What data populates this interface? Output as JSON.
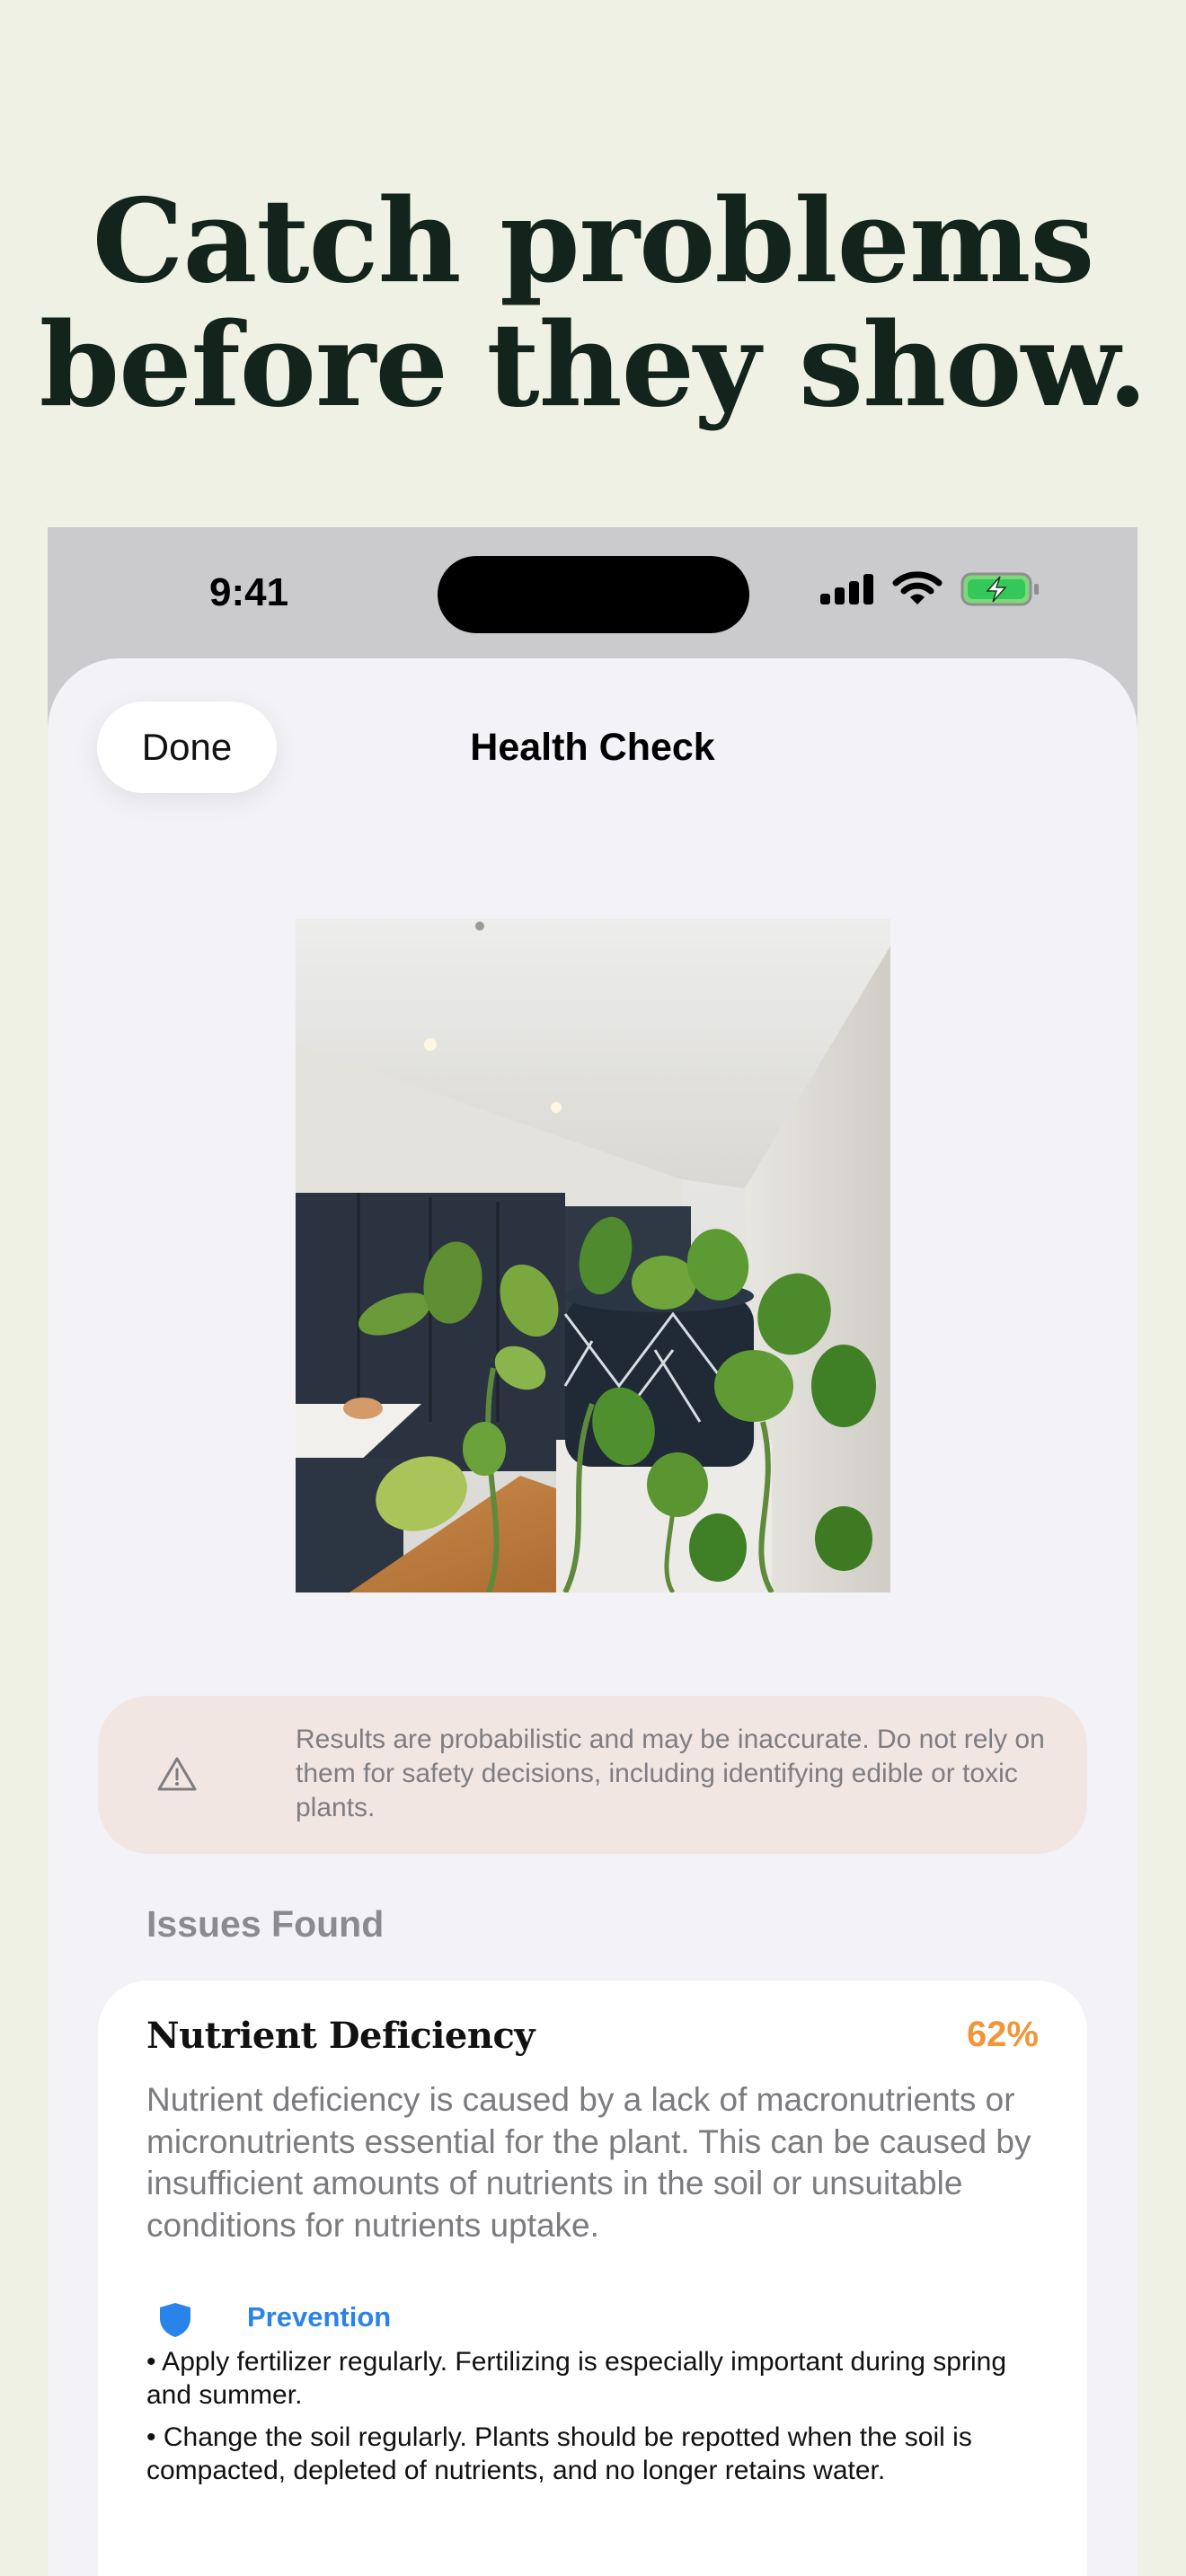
{
  "headline": {
    "line1": "Catch problems",
    "line2": "before they show."
  },
  "status_bar": {
    "time": "9:41",
    "icons": [
      "cellular-signal-icon",
      "wifi-icon",
      "battery-charging-icon"
    ]
  },
  "nav": {
    "done_label": "Done",
    "title": "Health Check"
  },
  "photo": {
    "subject": "pothos-plant-photo"
  },
  "disclaimer": {
    "icon": "warning-triangle-icon",
    "text": "Results are probabilistic and may be inaccurate. Do not rely on them for safety decisions, including identifying edible or toxic plants."
  },
  "issues": {
    "section_label": "Issues Found",
    "items": [
      {
        "title": "Nutrient Deficiency",
        "confidence": "62%",
        "description": "Nutrient deficiency is caused by a lack of macronutrients or micronutrients essential for the plant. This can be caused by insufficient amounts of nutrients in the soil or unsuitable conditions for nutrients uptake.",
        "prevention_label": "Prevention",
        "prevention_icon": "shield-icon",
        "prevention_tips": [
          "• Apply fertilizer regularly. Fertilizing is especially important during spring and summer.",
          "• Change the soil regularly. Plants should be repotted when the soil is compacted, depleted of nutrients, and no longer retains water."
        ]
      }
    ]
  },
  "colors": {
    "page_background": "#eff1e4",
    "headline": "#12241b",
    "sheet_background": "#f2f2f7",
    "disclaimer_background": "#f2e6e3",
    "confidence": "#f0963a",
    "prevention_accent": "#2a83e8",
    "battery_charging": "#34c759"
  }
}
